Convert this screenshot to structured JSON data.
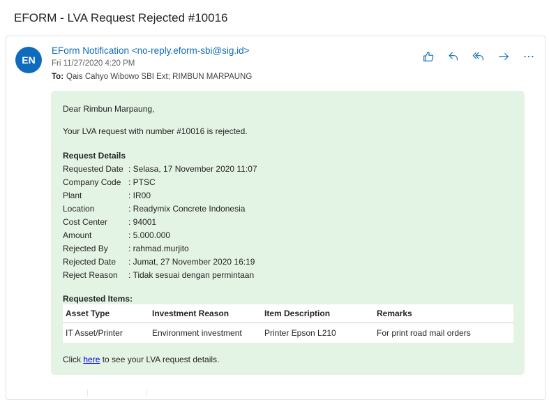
{
  "subject": "EFORM - LVA Request Rejected #10016",
  "header": {
    "avatar_initials": "EN",
    "sender": "EForm Notification <no-reply.eform-sbi@sig.id>",
    "date": "Fri 11/27/2020 4:20 PM",
    "to_label": "To:",
    "to_value": "Qais Cahyo Wibowo SBI Ext; RIMBUN MARPAUNG"
  },
  "actions": [
    {
      "icon": "like-icon"
    },
    {
      "icon": "reply-icon"
    },
    {
      "icon": "reply-all-icon"
    },
    {
      "icon": "forward-icon"
    },
    {
      "icon": "more-icon"
    }
  ],
  "body": {
    "greeting": "Dear Rimbun Marpaung,",
    "intro": "Your LVA request with number #10016 is rejected.",
    "details_heading": "Request Details",
    "details": [
      {
        "label": "Requested Date",
        "value": ": Selasa, 17 November 2020 11:07"
      },
      {
        "label": "Company Code",
        "value": ": PTSC"
      },
      {
        "label": "Plant",
        "value": ": IR00"
      },
      {
        "label": "Location",
        "value": ": Readymix Concrete Indonesia"
      },
      {
        "label": "Cost Center",
        "value": ": 94001"
      },
      {
        "label": "Amount",
        "value": ": 5.000.000"
      },
      {
        "label": "Rejected By",
        "value": ": rahmad.murjito"
      },
      {
        "label": "Rejected Date",
        "value": ": Jumat, 27 November 2020 16:19"
      },
      {
        "label": "Reject Reason",
        "value": ": Tidak sesuai dengan permintaan"
      }
    ],
    "items_heading": "Requested Items:",
    "items_columns": [
      "Asset Type",
      "Investment Reason",
      "Item Description",
      "Remarks"
    ],
    "items_rows": [
      [
        "IT Asset/Printer",
        "Environment investment",
        "Printer Epson L210",
        "For print road mail orders"
      ]
    ],
    "click_prefix": "Click ",
    "click_link": "here",
    "click_suffix": " to see your LVA request details."
  }
}
